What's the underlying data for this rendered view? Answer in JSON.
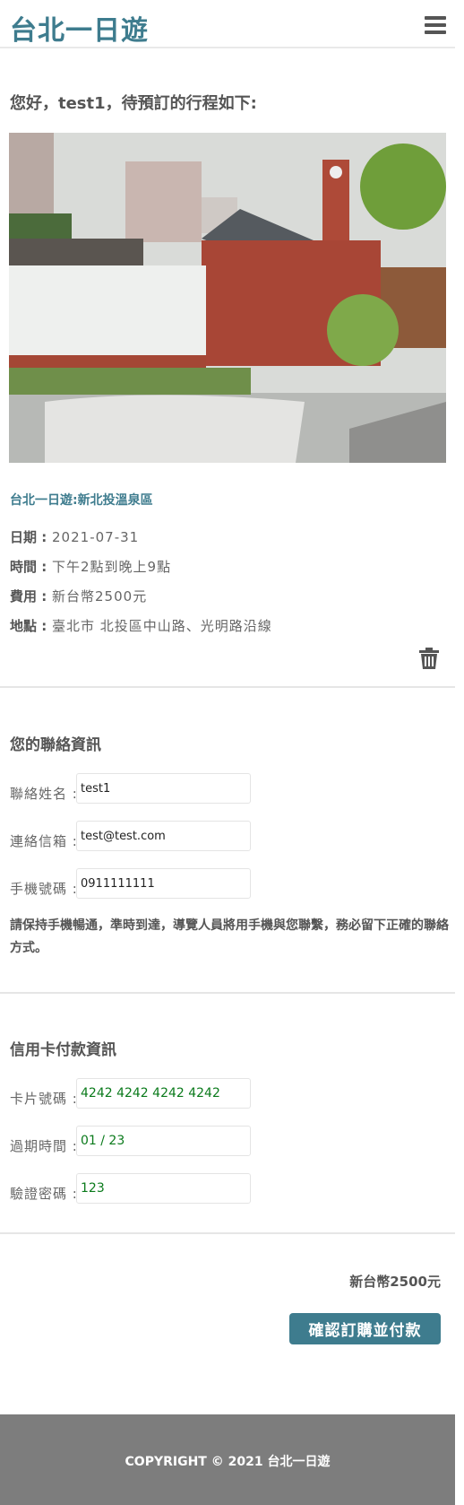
{
  "header": {
    "brand": "台北一日遊",
    "menu_icon": "hamburger-menu-icon"
  },
  "greeting": "您好，test1，待預訂的行程如下:",
  "trip": {
    "title": "台北一日遊:新北投溫泉區",
    "date_label": "日期 :",
    "date_value": "2021-07-31",
    "time_label": "時間 :",
    "time_value": "下午2點到晚上9點",
    "fee_label": "費用 :",
    "fee_value": "新台幣2500元",
    "location_label": "地點 :",
    "location_value": "臺北市 北投區中山路、光明路沿線"
  },
  "contact": {
    "title": "您的聯絡資訊",
    "name_label": "聯絡姓名 :",
    "name_value": "test1",
    "email_label": "連絡信箱 :",
    "email_value": "test@test.com",
    "phone_label": "手機號碼 :",
    "phone_value": "0911111111",
    "notice": "請保持手機暢通，準時到達，導覽人員將用手機與您聯繫，務必留下正確的聯絡方式。"
  },
  "payment": {
    "title": "信用卡付款資訊",
    "card_label": "卡片號碼 :",
    "card_value": "4242 4242 4242 4242",
    "expiry_label": "過期時間 :",
    "expiry_value": "01 / 23",
    "cvc_label": "驗證密碼 :",
    "cvc_value": "123"
  },
  "order": {
    "total": "新台幣2500元",
    "confirm_label": "確認訂購並付款"
  },
  "footer": {
    "copyright": "COPYRIGHT © 2021 台北一日遊"
  },
  "colors": {
    "accent": "#3e7c8e",
    "footer_bg": "#7d7d7d",
    "card_text": "#0a7a1b"
  }
}
